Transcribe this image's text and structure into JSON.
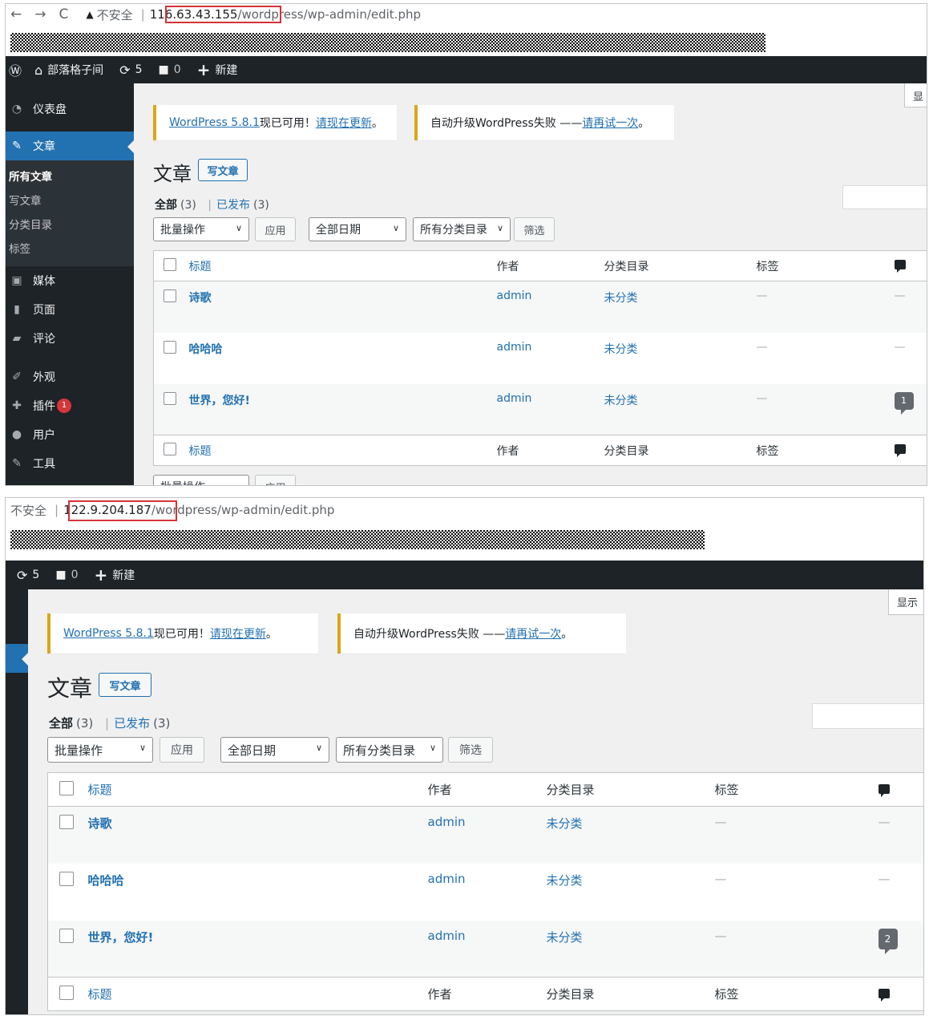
{
  "p1": {
    "browser": {
      "back": "←",
      "forward": "→",
      "reload": "C",
      "warning_icon": "▲",
      "insecure": "不安全",
      "separator": "|",
      "host": "116.63.43.155",
      "path": "/wordpress/wp-admin/edit.php"
    },
    "adminbar": {
      "wp_logo": "Ⓦ",
      "site_icon": "⌂",
      "site_name": "部落格子间",
      "updates_icon": "⟳",
      "updates_count": "5",
      "comments_icon": "■",
      "comments_count": "0",
      "new_icon": "+",
      "new_label": "新建"
    },
    "sidebar": {
      "dashboard": "仪表盘",
      "posts": "文章",
      "sub_all": "所有文章",
      "sub_new": "写文章",
      "sub_cat": "分类目录",
      "sub_tag": "标签",
      "media": "媒体",
      "pages": "页面",
      "comments": "评论",
      "appearance": "外观",
      "plugins": "插件",
      "plugins_badge": "1",
      "users": "用户",
      "tools": "工具"
    },
    "screen_options": "显",
    "notice1": {
      "link": "WordPress 5.8.1",
      "text": "现已可用！",
      "update": "请现在更新",
      "end": "。"
    },
    "notice2": {
      "text": "自动升级WordPress失败 —— ",
      "retry": "请再试一次",
      "end": "。"
    },
    "title": "文章",
    "add_new": "写文章",
    "filter": {
      "all": "全部",
      "all_count": "(3)",
      "sep": "|",
      "published": "已发布",
      "published_count": "(3)"
    },
    "bulk": "批量操作",
    "apply": "应用",
    "dates": "全部日期",
    "cats": "所有分类目录",
    "filter_btn": "筛选",
    "bottom_bulk": "批量操作",
    "bottom_apply": "应用",
    "cols": {
      "title": "标题",
      "author": "作者",
      "categories": "分类目录",
      "tags": "标签"
    },
    "rows": [
      {
        "title": "诗歌",
        "author": "admin",
        "category": "未分类",
        "tags": "—",
        "comments": "—"
      },
      {
        "title": "哈哈哈",
        "author": "admin",
        "category": "未分类",
        "tags": "—",
        "comments": "—"
      },
      {
        "title": "世界，您好!",
        "author": "admin",
        "category": "未分类",
        "tags": "—",
        "comments": "1"
      }
    ]
  },
  "p2": {
    "browser": {
      "insecure": "不安全",
      "separator": "|",
      "host": "122.9.204.187",
      "path": "/wordpress/wp-admin/edit.php"
    },
    "adminbar": {
      "updates_icon": "⟳",
      "updates_count": "5",
      "comments_icon": "■",
      "comments_count": "0",
      "new_icon": "+",
      "new_label": "新建"
    },
    "screen_options": "显示",
    "notice1": {
      "link": "WordPress 5.8.1",
      "text": "现已可用！",
      "update": "请现在更新",
      "end": "。"
    },
    "notice2": {
      "text": "自动升级WordPress失败 —— ",
      "retry": "请再试一次",
      "end": "。"
    },
    "title": "文章",
    "add_new": "写文章",
    "filter": {
      "all": "全部",
      "all_count": "(3)",
      "sep": "|",
      "published": "已发布",
      "published_count": "(3)"
    },
    "bulk": "批量操作",
    "apply": "应用",
    "dates": "全部日期",
    "cats": "所有分类目录",
    "filter_btn": "筛选",
    "cols": {
      "title": "标题",
      "author": "作者",
      "categories": "分类目录",
      "tags": "标签"
    },
    "rows": [
      {
        "title": "诗歌",
        "author": "admin",
        "category": "未分类",
        "tags": "—",
        "comments": "—"
      },
      {
        "title": "哈哈哈",
        "author": "admin",
        "category": "未分类",
        "tags": "—",
        "comments": "—"
      },
      {
        "title": "世界，您好!",
        "author": "admin",
        "category": "未分类",
        "tags": "—",
        "comments": "2"
      }
    ]
  }
}
